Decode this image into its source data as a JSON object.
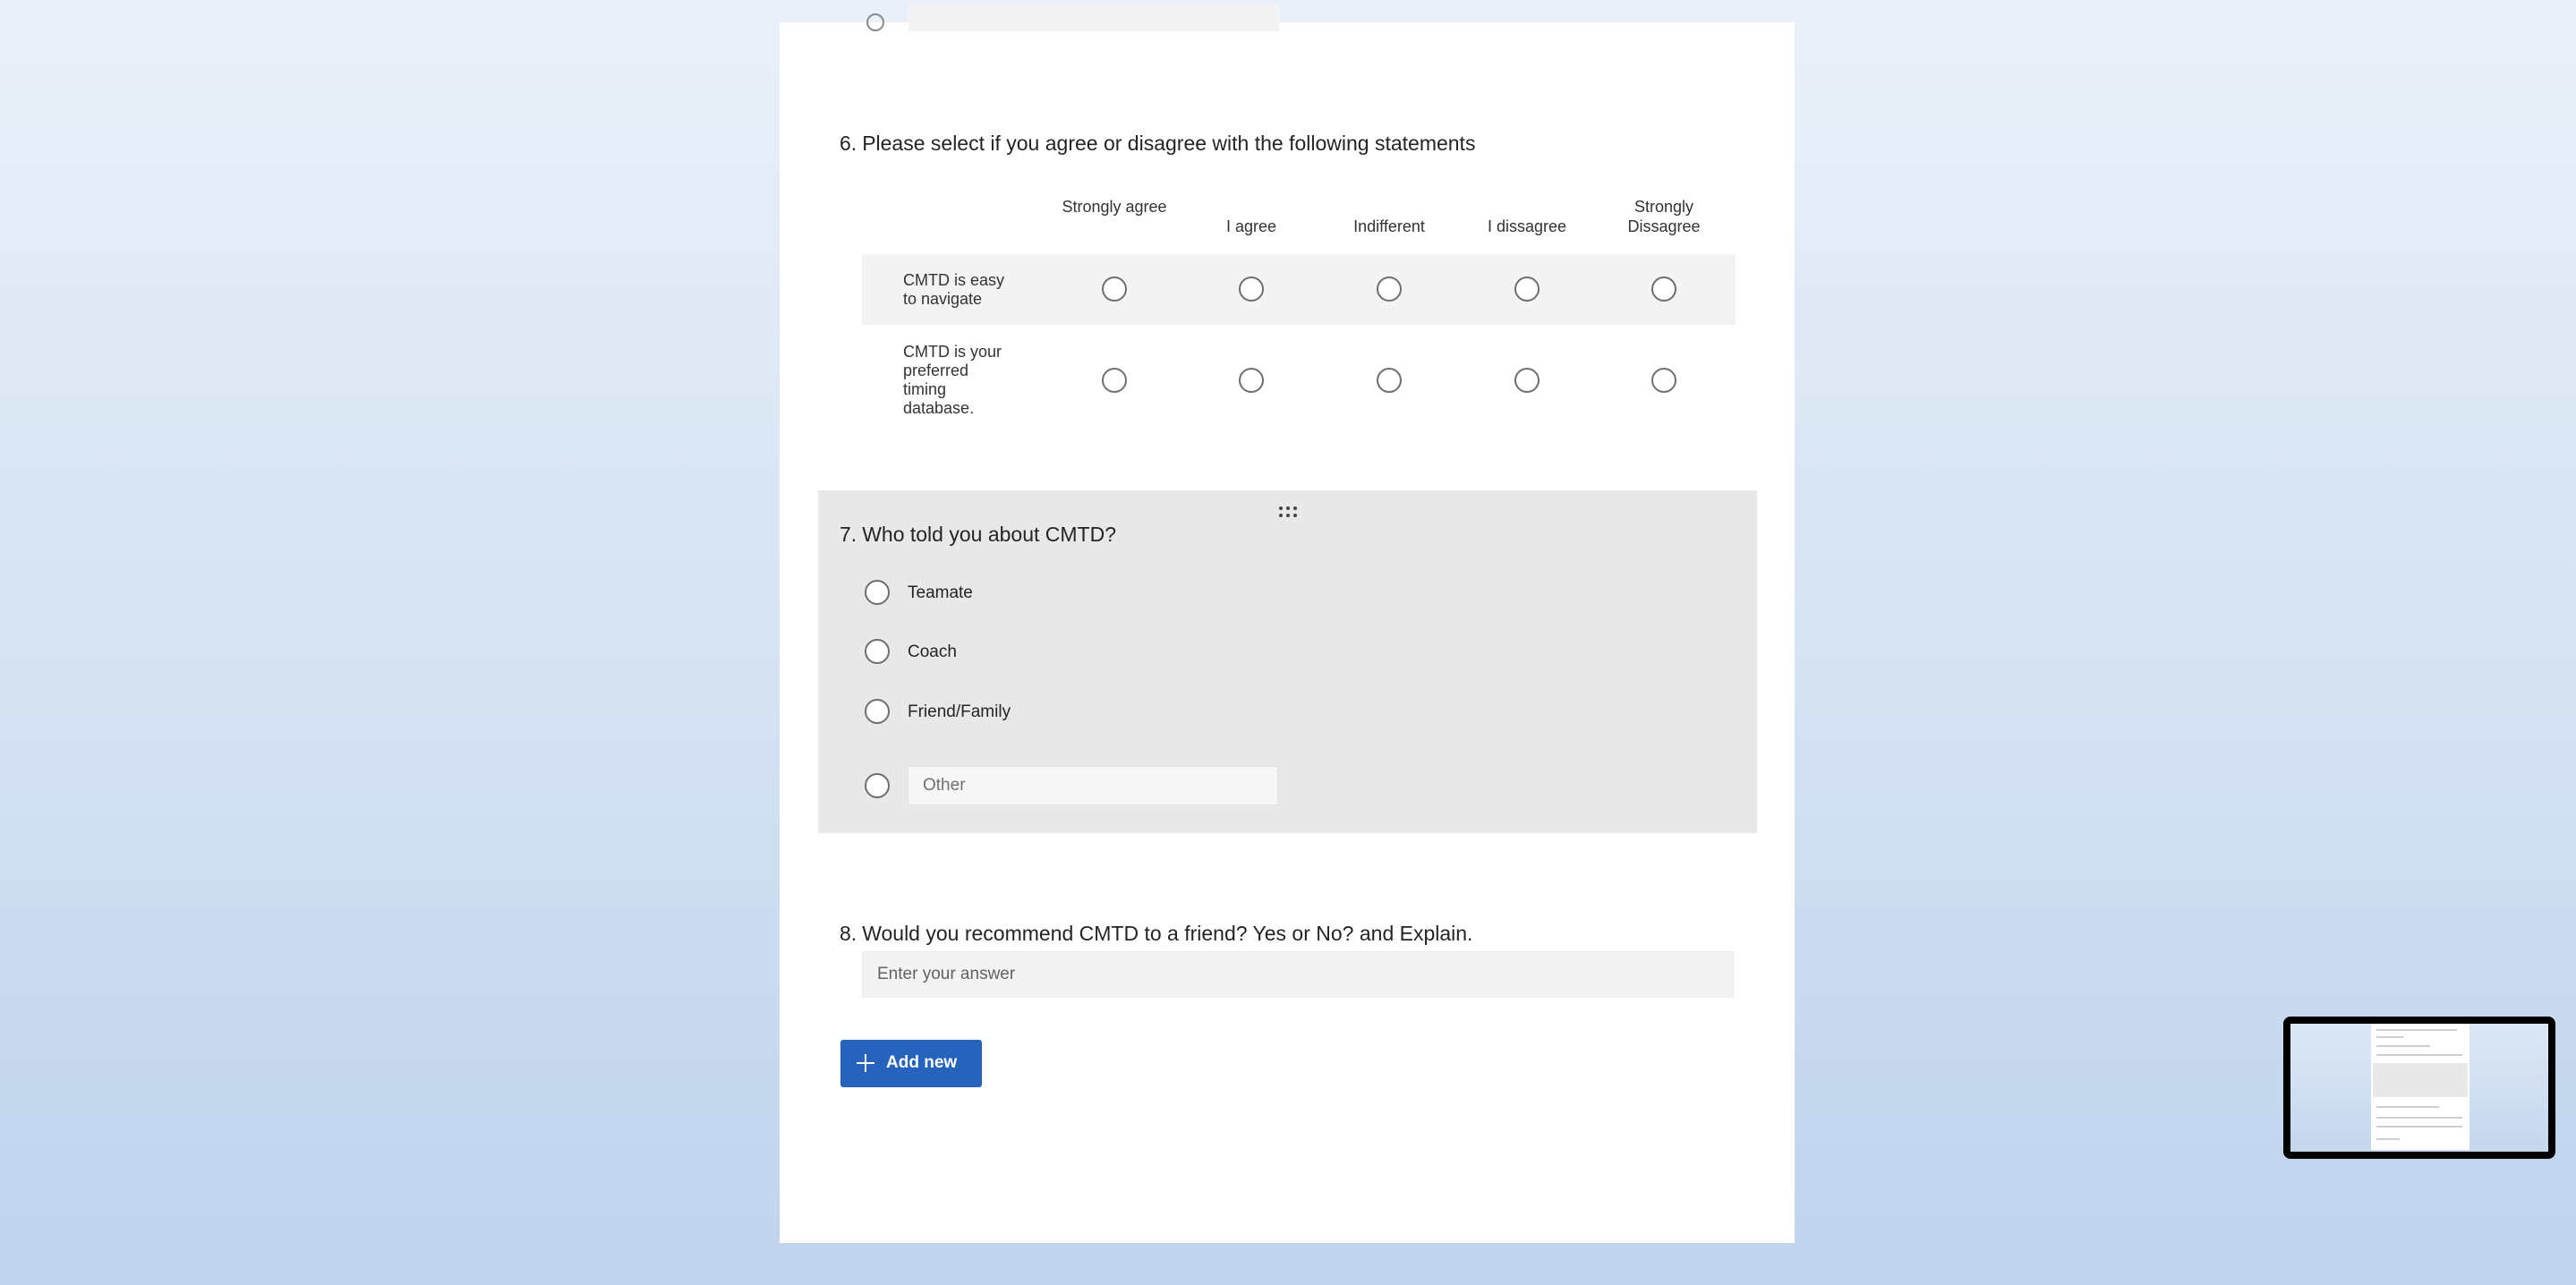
{
  "form": {
    "q6": {
      "number": "6.",
      "title": "Please select if you agree or disagree with the following statements",
      "columns": [
        "Strongly agree",
        "I agree",
        "Indifferent",
        "I dissagree",
        "Strongly Dissagree"
      ],
      "rows": [
        {
          "statement": "CMTD is easy to navigate"
        },
        {
          "statement": "CMTD is your preferred timing database."
        }
      ]
    },
    "q7": {
      "number": "7.",
      "title": "Who told you about CMTD?",
      "options": [
        "Teamate",
        "Coach",
        "Friend/Family"
      ],
      "other_placeholder": "Other"
    },
    "q8": {
      "number": "8.",
      "title": "Would you recommend CMTD to a friend? Yes or No? and Explain.",
      "answer_placeholder": "Enter your answer"
    },
    "add_new_label": "Add new"
  },
  "colors": {
    "accent": "#2563bd",
    "selected_section_bg": "#e8e8e8",
    "row_shade": "#f3f3f3"
  },
  "icons": [
    "drag-handle-icon",
    "plus-icon"
  ]
}
